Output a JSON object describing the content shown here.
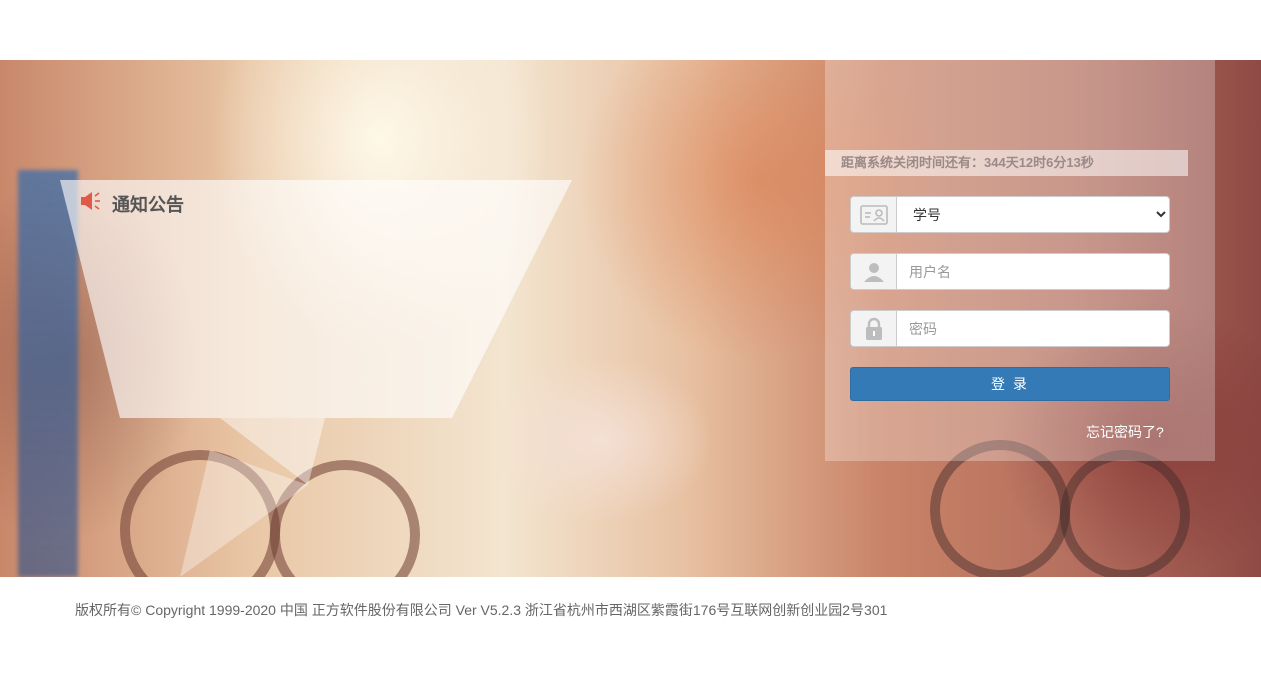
{
  "notice": {
    "title": "通知公告"
  },
  "login": {
    "countdown": "距离系统关闭时间还有：344天12时6分13秒",
    "role_select": {
      "selected": "学号",
      "options": [
        "学号"
      ]
    },
    "username_placeholder": "用户名",
    "password_placeholder": "密码",
    "login_label": "登 录",
    "forgot_label": "忘记密码了?"
  },
  "footer": {
    "text": "版权所有© Copyright 1999-2020 中国 正方软件股份有限公司 Ver V5.2.3  浙江省杭州市西湖区紫霞街176号互联网创新创业园2号301"
  },
  "colors": {
    "primary_button": "#337ab7",
    "footer_text": "#666666",
    "notice_icon": "#e05a4a"
  },
  "icons": {
    "notice": "megaphone-icon",
    "role": "id-card-icon",
    "user": "user-icon",
    "password": "lock-icon"
  }
}
